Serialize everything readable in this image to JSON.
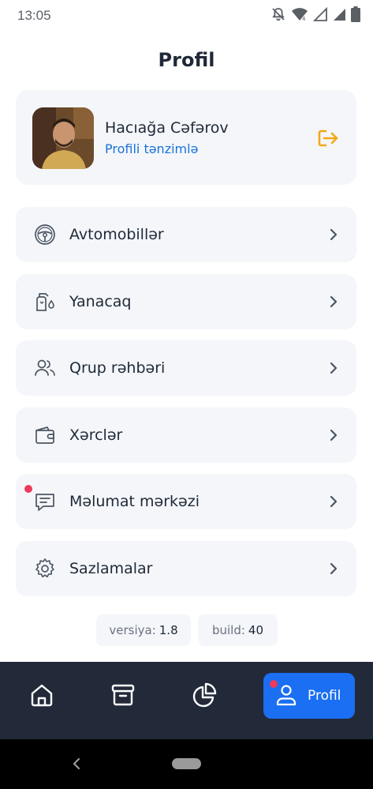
{
  "status_bar": {
    "time": "13:05"
  },
  "header": {
    "title": "Profil"
  },
  "profile": {
    "name": "Hacıağa Cəfərov",
    "edit_link": "Profili tənzimlə"
  },
  "menu": {
    "items": [
      {
        "label": "Avtomobillər",
        "icon": "steering-wheel-icon"
      },
      {
        "label": "Yanacaq",
        "icon": "fuel-pump-icon"
      },
      {
        "label": "Qrup rəhbəri",
        "icon": "users-icon"
      },
      {
        "label": "Xərclər",
        "icon": "wallet-icon"
      },
      {
        "label": "Məlumat mərkəzi",
        "icon": "message-icon",
        "has_notification": true
      },
      {
        "label": "Sazlamalar",
        "icon": "gear-icon"
      }
    ]
  },
  "version": {
    "version_label": "versiya:",
    "version_value": "1.8",
    "build_label": "build:",
    "build_value": "40"
  },
  "tabbar": {
    "tabs": [
      {
        "icon": "home-icon"
      },
      {
        "icon": "archive-icon"
      },
      {
        "icon": "pie-chart-icon"
      },
      {
        "icon": "user-icon",
        "label": "Profil",
        "active": true,
        "has_notification": true
      }
    ]
  },
  "colors": {
    "accent": "#1a6ff2",
    "link": "#1a73d9",
    "logout": "#f2a818",
    "notification": "#ef3a5d",
    "tabbar_bg": "#222a3a",
    "card_bg": "#f4f6fa"
  }
}
